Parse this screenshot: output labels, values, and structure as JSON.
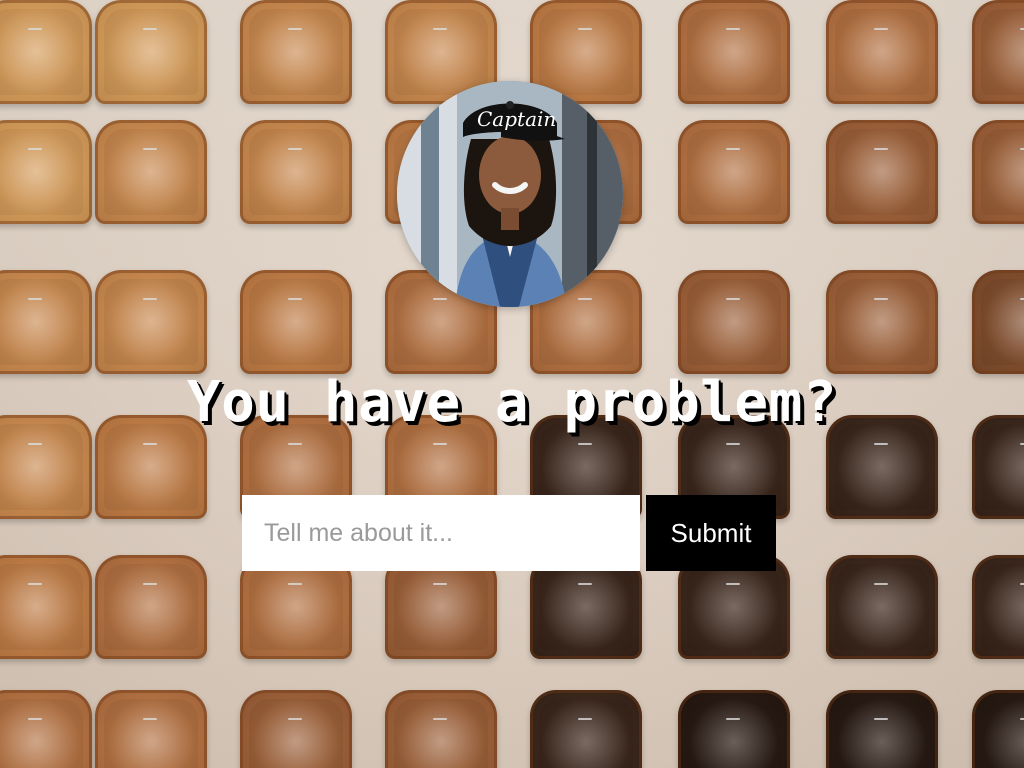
{
  "hero": {
    "headline": "You have a problem?"
  },
  "avatar": {
    "cap_text": "Captain"
  },
  "form": {
    "input_placeholder": "Tell me about it...",
    "input_value": "",
    "submit_label": "Submit"
  },
  "background": {
    "pattern": "grid of toast slices from light to burnt"
  },
  "colors": {
    "button_bg": "#000000",
    "button_text": "#ffffff",
    "input_bg": "#ffffff",
    "headline_text": "#ffffff",
    "headline_shadow": "#000000"
  }
}
